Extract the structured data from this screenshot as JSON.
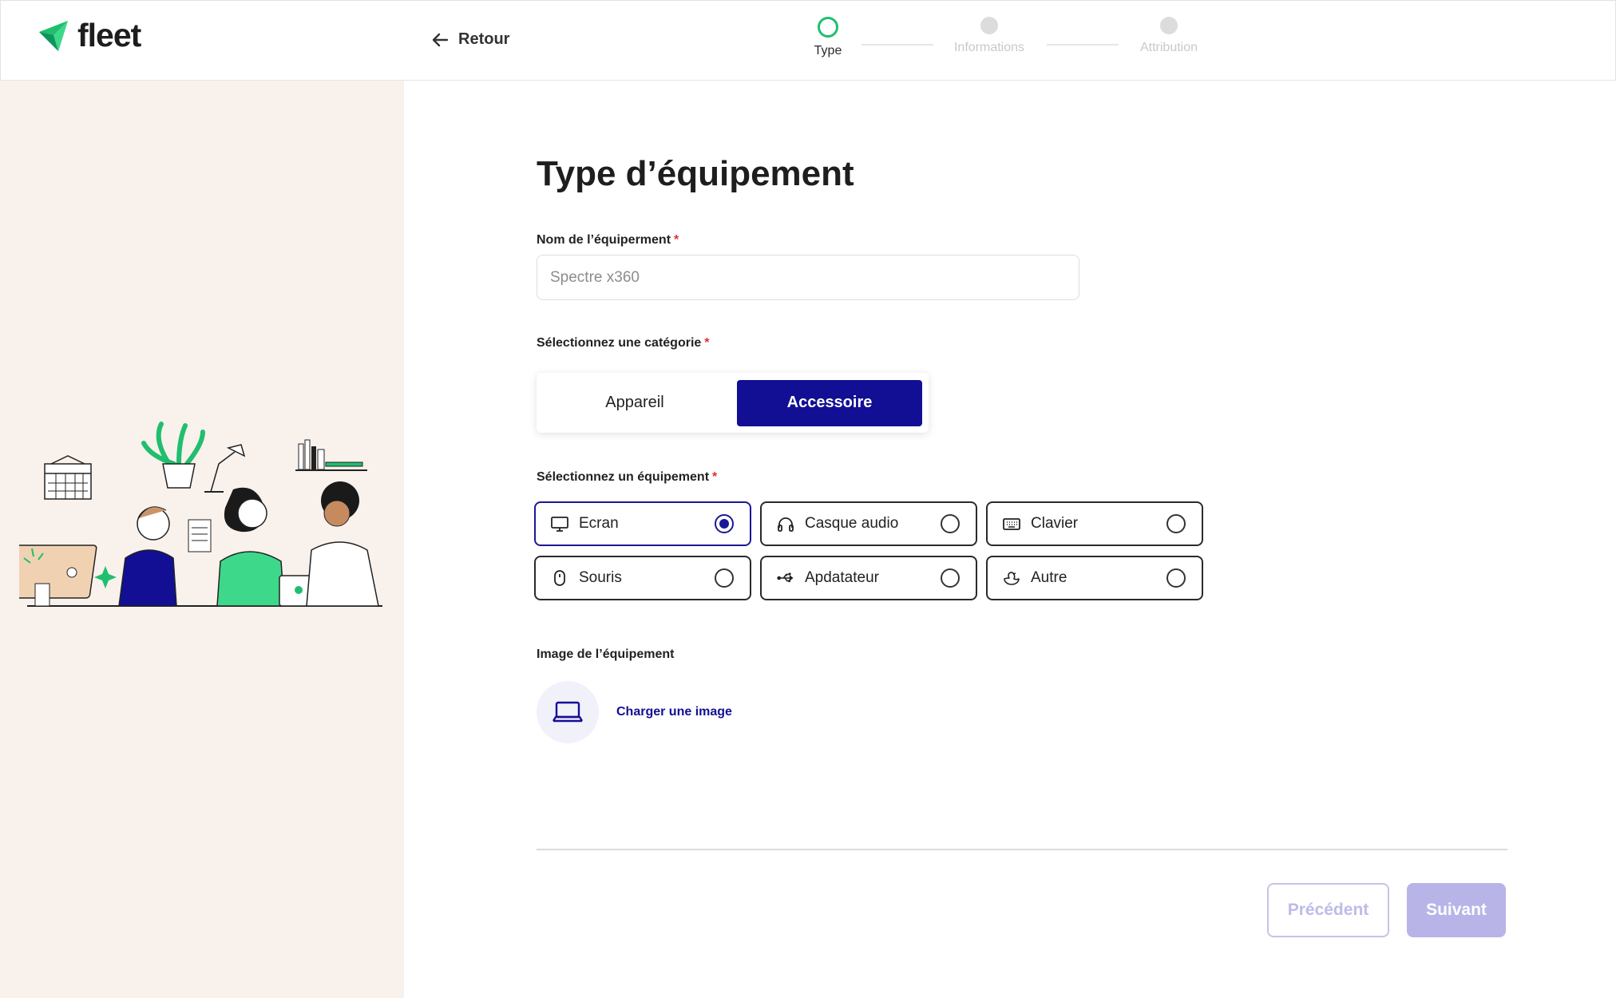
{
  "brand": {
    "name": "fleet",
    "accent": "#1fbf6e",
    "primary": "#120f95"
  },
  "header": {
    "back_label": "Retour",
    "steps": [
      {
        "label": "Type",
        "state": "active"
      },
      {
        "label": "Informations",
        "state": "inactive"
      },
      {
        "label": "Attribution",
        "state": "inactive"
      }
    ]
  },
  "form": {
    "title": "Type d’équipement",
    "name_label": "Nom de l’équiperment",
    "name_placeholder": "Spectre x360",
    "required_mark": "*",
    "category_label": "Sélectionnez une catégorie",
    "categories": [
      {
        "label": "Appareil",
        "selected": false
      },
      {
        "label": "Accessoire",
        "selected": true
      }
    ],
    "equipment_label": "Sélectionnez un équipement",
    "equipment": [
      {
        "label": "Ecran",
        "icon": "monitor-icon",
        "selected": true
      },
      {
        "label": "Casque audio",
        "icon": "headphones-icon",
        "selected": false
      },
      {
        "label": "Clavier",
        "icon": "keyboard-icon",
        "selected": false
      },
      {
        "label": "Souris",
        "icon": "mouse-icon",
        "selected": false
      },
      {
        "label": "Apdatateur",
        "icon": "usb-icon",
        "selected": false
      },
      {
        "label": "Autre",
        "icon": "duck-icon",
        "selected": false
      }
    ],
    "image_label": "Image de l’équipement",
    "upload_label": "Charger une image"
  },
  "footer": {
    "prev_label": "Précédent",
    "next_label": "Suivant"
  }
}
